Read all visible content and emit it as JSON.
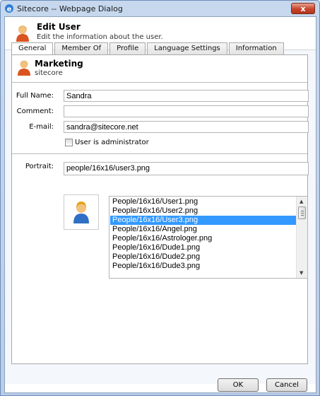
{
  "window": {
    "title": "Sitecore -- Webpage Dialog",
    "close_label": "x"
  },
  "header": {
    "title": "Edit User",
    "description": "Edit the information about the user."
  },
  "tabs": [
    {
      "label": "General",
      "active": true
    },
    {
      "label": "Member Of",
      "active": false
    },
    {
      "label": "Profile",
      "active": false
    },
    {
      "label": "Language Settings",
      "active": false
    },
    {
      "label": "Information",
      "active": false
    }
  ],
  "account": {
    "name": "Marketing",
    "domain": "sitecore"
  },
  "form": {
    "full_name_label": "Full Name:",
    "full_name_value": "Sandra",
    "comment_label": "Comment:",
    "comment_value": "",
    "email_label": "E-mail:",
    "email_value": "sandra@sitecore.net",
    "admin_label": "User is administrator",
    "admin_checked": false,
    "portrait_label": "Portrait:",
    "portrait_value": "people/16x16/user3.png"
  },
  "portrait_list": {
    "items": [
      "People/16x16/User1.png",
      "People/16x16/User2.png",
      "People/16x16/User3.png",
      "People/16x16/Angel.png",
      "People/16x16/Astrologer.png",
      "People/16x16/Dude1.png",
      "People/16x16/Dude2.png",
      "People/16x16/Dude3.png"
    ],
    "selected_index": 2
  },
  "buttons": {
    "ok": "OK",
    "cancel": "Cancel"
  },
  "colors": {
    "selection": "#3399ff",
    "title_bar": "#c7d8ee",
    "close_button": "#c7452c"
  }
}
